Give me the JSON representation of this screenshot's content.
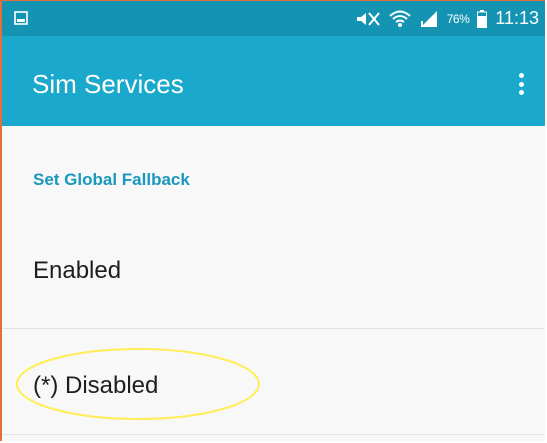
{
  "status_bar": {
    "battery": "76%",
    "time": "11:13",
    "icons": [
      "image-icon",
      "mute-vibrate-icon",
      "wifi-icon",
      "signal-icon",
      "battery-icon"
    ]
  },
  "app_bar": {
    "title": "Sim Services",
    "menu_icon": "more-vert-icon"
  },
  "settings": {
    "section_title": "Set Global Fallback",
    "options": [
      {
        "label": "Enabled",
        "selected": false
      },
      {
        "label": "(*) Disabled",
        "selected": true
      }
    ]
  },
  "colors": {
    "status_bar": "#1593b3",
    "app_bar": "#1aa8cc",
    "accent": "#1a98bd",
    "highlight": "#ffee55",
    "frame": "#e2703a"
  }
}
